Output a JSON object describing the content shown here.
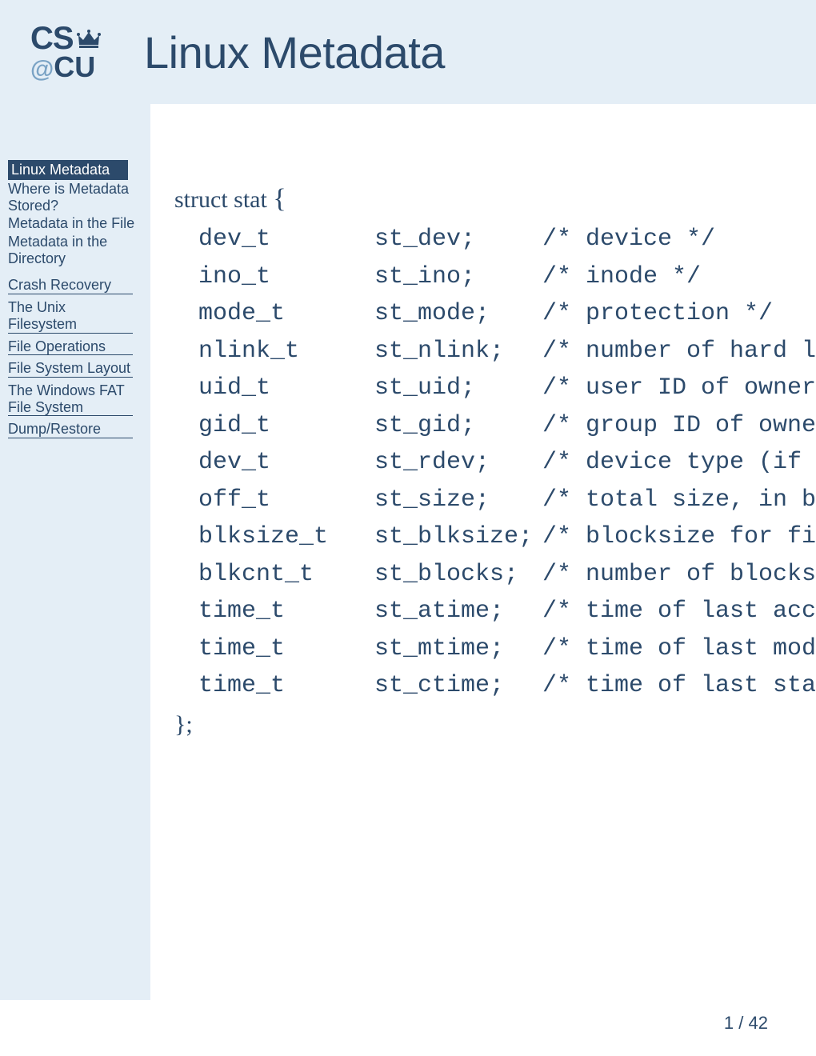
{
  "logo": {
    "cs": "CS",
    "at": "@",
    "cu": "CU"
  },
  "title": "Linux Metadata",
  "sidebar": {
    "active": "Linux Metadata",
    "sub": [
      "Where is Metadata Stored?",
      "Metadata in the File",
      "Metadata in the Directory"
    ],
    "topics": [
      "Crash Recovery",
      "The Unix Filesystem",
      "File Operations",
      "File System Layout",
      "The Windows FAT File System",
      "Dump/Restore"
    ]
  },
  "struct": {
    "open": "struct stat ",
    "brace_open": "{",
    "close": "};",
    "fields": [
      {
        "type": "dev_t",
        "name": "st_dev;",
        "comment": "/* device */"
      },
      {
        "type": "ino_t",
        "name": "st_ino;",
        "comment": "/* inode */"
      },
      {
        "type": "mode_t",
        "name": "st_mode;",
        "comment": "/* protection */"
      },
      {
        "type": "nlink_t",
        "name": "st_nlink;",
        "comment": "/* number of hard links */"
      },
      {
        "type": "uid_t",
        "name": "st_uid;",
        "comment": "/* user ID of owner */"
      },
      {
        "type": "gid_t",
        "name": "st_gid;",
        "comment": "/* group ID of owner */"
      },
      {
        "type": "dev_t",
        "name": "st_rdev;",
        "comment": "/* device type (if inode device) */"
      },
      {
        "type": "off_t",
        "name": "st_size;",
        "comment": "/* total size, in bytes */"
      },
      {
        "type": "blksize_t",
        "name": "st_blksize;",
        "comment": "/* blocksize for filesystem I/O */"
      },
      {
        "type": "blkcnt_t",
        "name": "st_blocks;",
        "comment": "/* number of blocks allocated */"
      },
      {
        "type": "time_t",
        "name": "st_atime;",
        "comment": "/* time of last access */"
      },
      {
        "type": "time_t",
        "name": "st_mtime;",
        "comment": "/* time of last modification */"
      },
      {
        "type": "time_t",
        "name": "st_ctime;",
        "comment": "/* time of last status change */"
      }
    ]
  },
  "footer": {
    "page": "1",
    "sep": " / ",
    "total": "42"
  }
}
